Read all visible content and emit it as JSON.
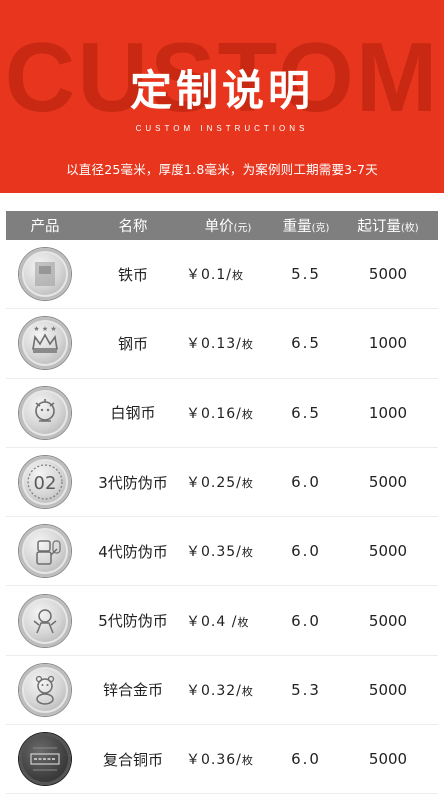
{
  "banner": {
    "watermark": "CUSTOM",
    "title": "定制说明",
    "subtitle": "CUSTOM INSTRUCTIONS",
    "description": "以直径25毫米，厚度1.8毫米，为案例则工期需要3-7天",
    "background_color": "#e8361e"
  },
  "table": {
    "headers": {
      "product": "产品",
      "name": "名称",
      "price": "单价",
      "price_unit": "(元)",
      "weight": "重量",
      "weight_unit": "(克)",
      "moq": "起订量",
      "moq_unit": "(枚)"
    },
    "header_color": "#7f7f7f",
    "rows": [
      {
        "icon": "blurred-coin-icon",
        "name": "铁币",
        "price": "￥0.1/",
        "per": "枚",
        "weight": "5.5",
        "moq": "5000"
      },
      {
        "icon": "crown-coin-icon",
        "name": "钢币",
        "price": "￥0.13/",
        "per": "枚",
        "weight": "6.5",
        "moq": "1000"
      },
      {
        "icon": "lion-coin-icon",
        "name": "白钢币",
        "price": "￥0.16/",
        "per": "枚",
        "weight": "6.5",
        "moq": "1000"
      },
      {
        "icon": "number-02-coin-icon",
        "name": "3代防伪币",
        "price": "￥0.25/",
        "per": "枚",
        "weight": "6.0",
        "moq": "5000",
        "coin_text": "02"
      },
      {
        "icon": "robot-coin-icon",
        "name": "4代防伪币",
        "price": "￥0.35/",
        "per": "枚",
        "weight": "6.0",
        "moq": "5000"
      },
      {
        "icon": "character-coin-icon",
        "name": "5代防伪币",
        "price": "￥0.4 /",
        "per": "枚",
        "weight": "6.0",
        "moq": "5000"
      },
      {
        "icon": "bear-coin-icon",
        "name": "锌合金币",
        "price": "￥0.32/",
        "per": "枚",
        "weight": "5.3",
        "moq": "5000"
      },
      {
        "icon": "engraved-dark-coin-icon",
        "name": "复合铜币",
        "price": "￥0.36/",
        "per": "枚",
        "weight": "6.0",
        "moq": "5000"
      }
    ]
  }
}
